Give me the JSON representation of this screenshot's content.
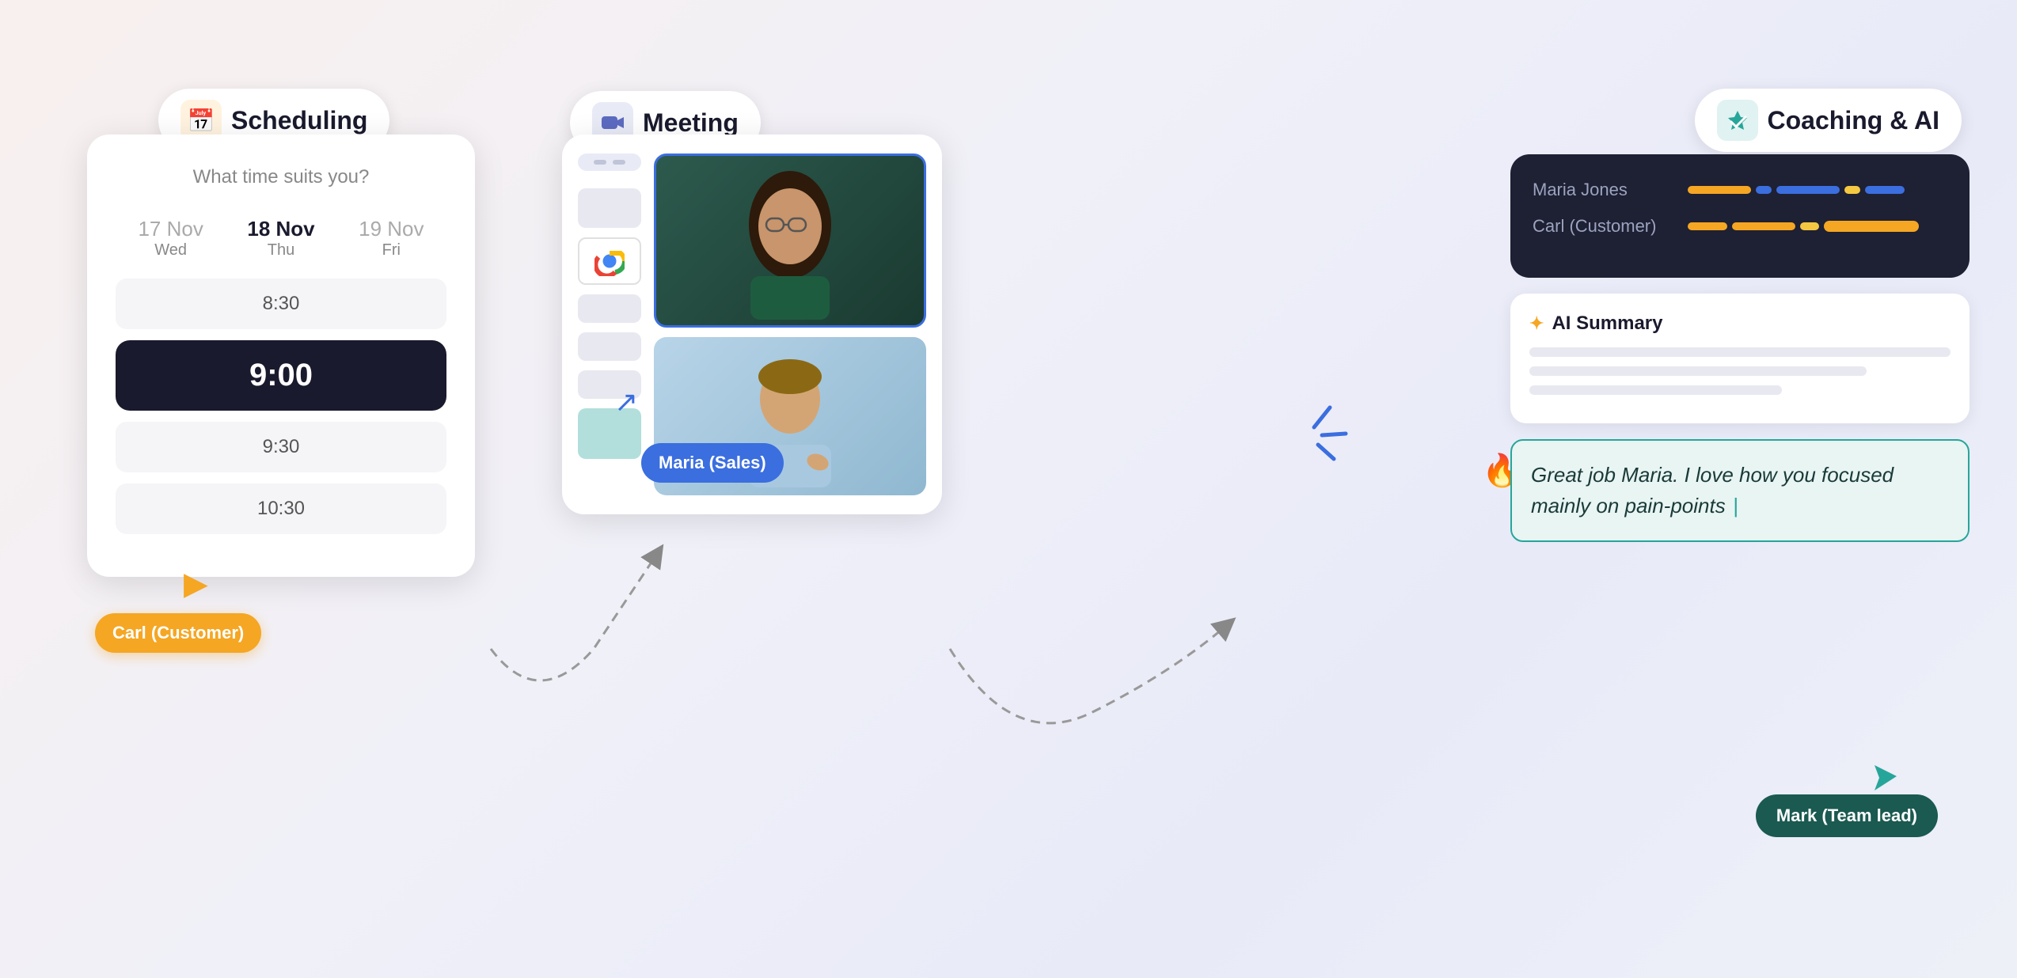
{
  "scheduling": {
    "pill_label": "Scheduling",
    "subtitle": "What time suits you?",
    "dates": [
      {
        "num": "17 Nov",
        "day": "Wed",
        "muted": true
      },
      {
        "num": "18 Nov",
        "day": "Thu",
        "muted": false
      },
      {
        "num": "19 Nov",
        "day": "Fri",
        "muted": true
      }
    ],
    "times": [
      "8:30",
      "9:00",
      "9:30",
      "10:30"
    ],
    "selected_time": "9:00",
    "carl_tag": "Carl (Customer)"
  },
  "meeting": {
    "pill_label": "Meeting",
    "maria_tag": "Maria (Sales)"
  },
  "coaching": {
    "pill_label": "Coaching & AI",
    "participants": [
      {
        "name": "Maria Jones"
      },
      {
        "name": "Carl (Customer)"
      }
    ],
    "ai_summary_label": "AI Summary",
    "comment_text": "Great job Maria. I love how you focused mainly on pain-points",
    "mark_tag": "Mark (Team lead)"
  }
}
